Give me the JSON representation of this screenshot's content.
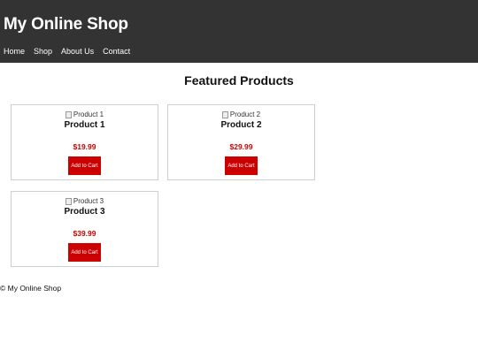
{
  "header": {
    "title": "My Online Shop",
    "nav": [
      "Home",
      "Shop",
      "About Us",
      "Contact"
    ]
  },
  "main": {
    "section_title": "Featured Products",
    "products": [
      {
        "image_alt": "Product 1",
        "name": "Product 1",
        "price": "$19.99",
        "button": "Add to Cart"
      },
      {
        "image_alt": "Product 2",
        "name": "Product 2",
        "price": "$29.99",
        "button": "Add to Cart"
      },
      {
        "image_alt": "Product 3",
        "name": "Product 3",
        "price": "$39.99",
        "button": "Add to Cart"
      }
    ]
  },
  "footer": {
    "text": "© My Online Shop"
  },
  "colors": {
    "header_bg": "#333333",
    "accent": "#cc0000"
  }
}
